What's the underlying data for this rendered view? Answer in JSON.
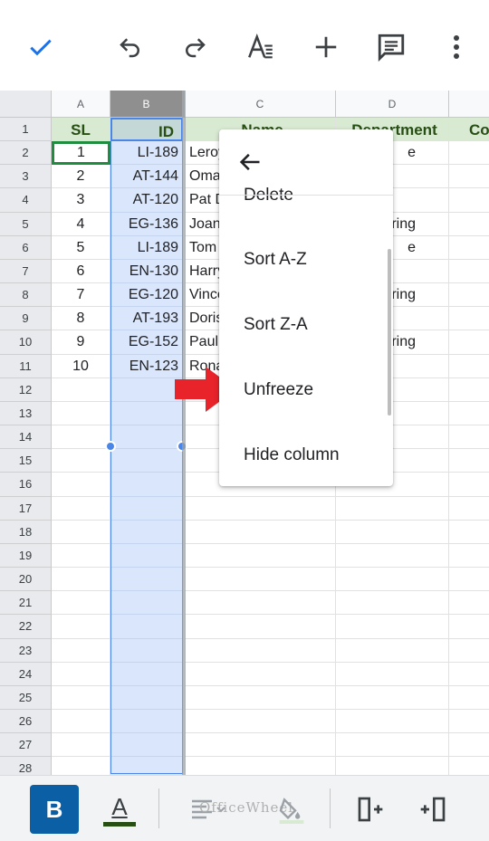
{
  "toolbar": {
    "done": "check-icon",
    "undo": "undo-icon",
    "redo": "redo-icon",
    "format_text": "text-format-icon",
    "insert": "add-icon",
    "comment": "comment-icon",
    "more": "more-vert-icon"
  },
  "columns": [
    "A",
    "B",
    "C",
    "D"
  ],
  "rows": [
    "1",
    "2",
    "3",
    "4",
    "5",
    "6",
    "7",
    "8",
    "9",
    "10",
    "11",
    "12",
    "13",
    "14",
    "15",
    "16",
    "17",
    "18",
    "19",
    "20",
    "21",
    "22",
    "23",
    "24",
    "25",
    "26",
    "27",
    "28"
  ],
  "header_row": {
    "sl": "SL",
    "id": "ID",
    "name": "Name",
    "department": "Department",
    "extra": "Co"
  },
  "data_rows": [
    {
      "sl": "1",
      "id": "LI-189",
      "name": "Leroy",
      "dept": "e"
    },
    {
      "sl": "2",
      "id": "AT-144",
      "name": "Omar",
      "dept": ""
    },
    {
      "sl": "3",
      "id": "AT-120",
      "name": "Pat D",
      "dept": ""
    },
    {
      "sl": "4",
      "id": "EG-136",
      "name": "Joan",
      "dept": "ring"
    },
    {
      "sl": "5",
      "id": "LI-189",
      "name": "Tom",
      "dept": "e"
    },
    {
      "sl": "6",
      "id": "EN-130",
      "name": "Harry",
      "dept": ""
    },
    {
      "sl": "7",
      "id": "EG-120",
      "name": "Vince",
      "dept": "ring"
    },
    {
      "sl": "8",
      "id": "AT-193",
      "name": "Doris",
      "dept": ""
    },
    {
      "sl": "9",
      "id": "EG-152",
      "name": "Paul",
      "dept": "ring"
    },
    {
      "sl": "10",
      "id": "EN-123",
      "name": "Rona",
      "dept": ""
    }
  ],
  "context_menu": {
    "back": "arrow-back-icon",
    "items": [
      "Delete",
      "Sort A-Z",
      "Sort Z-A",
      "Unfreeze",
      "Hide column"
    ]
  },
  "annotation": {
    "arrow_color": "#e8232a",
    "points_to": "Unfreeze"
  },
  "bottom_toolbar": {
    "bold": "B",
    "text_color_letter": "A",
    "watermark": "OfficeWheel"
  },
  "colors": {
    "header_fill": "#d9ead3",
    "header_text": "#274e13",
    "selection_fill": "#dae6fc",
    "selection_border": "#4a86e8",
    "active_cell_border": "#1e8e3e",
    "bold_button_bg": "#0b5fa5"
  }
}
